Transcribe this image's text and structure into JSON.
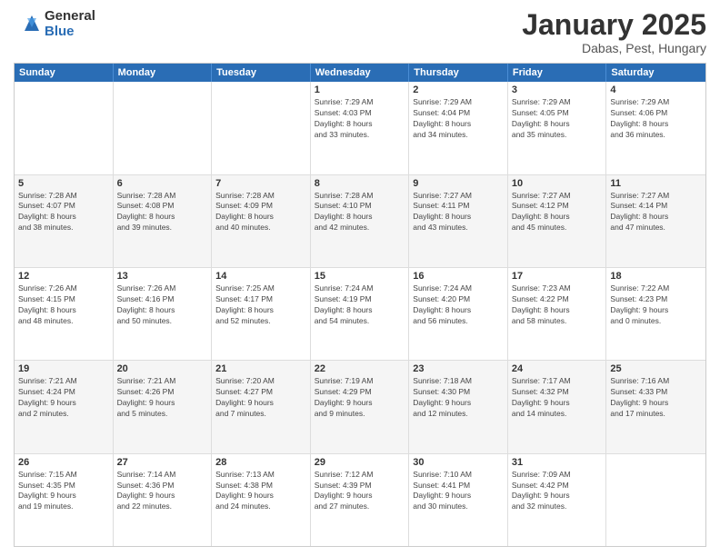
{
  "logo": {
    "general": "General",
    "blue": "Blue"
  },
  "title": "January 2025",
  "subtitle": "Dabas, Pest, Hungary",
  "header_days": [
    "Sunday",
    "Monday",
    "Tuesday",
    "Wednesday",
    "Thursday",
    "Friday",
    "Saturday"
  ],
  "rows": [
    [
      {
        "day": "",
        "text": ""
      },
      {
        "day": "",
        "text": ""
      },
      {
        "day": "",
        "text": ""
      },
      {
        "day": "1",
        "text": "Sunrise: 7:29 AM\nSunset: 4:03 PM\nDaylight: 8 hours\nand 33 minutes."
      },
      {
        "day": "2",
        "text": "Sunrise: 7:29 AM\nSunset: 4:04 PM\nDaylight: 8 hours\nand 34 minutes."
      },
      {
        "day": "3",
        "text": "Sunrise: 7:29 AM\nSunset: 4:05 PM\nDaylight: 8 hours\nand 35 minutes."
      },
      {
        "day": "4",
        "text": "Sunrise: 7:29 AM\nSunset: 4:06 PM\nDaylight: 8 hours\nand 36 minutes."
      }
    ],
    [
      {
        "day": "5",
        "text": "Sunrise: 7:28 AM\nSunset: 4:07 PM\nDaylight: 8 hours\nand 38 minutes."
      },
      {
        "day": "6",
        "text": "Sunrise: 7:28 AM\nSunset: 4:08 PM\nDaylight: 8 hours\nand 39 minutes."
      },
      {
        "day": "7",
        "text": "Sunrise: 7:28 AM\nSunset: 4:09 PM\nDaylight: 8 hours\nand 40 minutes."
      },
      {
        "day": "8",
        "text": "Sunrise: 7:28 AM\nSunset: 4:10 PM\nDaylight: 8 hours\nand 42 minutes."
      },
      {
        "day": "9",
        "text": "Sunrise: 7:27 AM\nSunset: 4:11 PM\nDaylight: 8 hours\nand 43 minutes."
      },
      {
        "day": "10",
        "text": "Sunrise: 7:27 AM\nSunset: 4:12 PM\nDaylight: 8 hours\nand 45 minutes."
      },
      {
        "day": "11",
        "text": "Sunrise: 7:27 AM\nSunset: 4:14 PM\nDaylight: 8 hours\nand 47 minutes."
      }
    ],
    [
      {
        "day": "12",
        "text": "Sunrise: 7:26 AM\nSunset: 4:15 PM\nDaylight: 8 hours\nand 48 minutes."
      },
      {
        "day": "13",
        "text": "Sunrise: 7:26 AM\nSunset: 4:16 PM\nDaylight: 8 hours\nand 50 minutes."
      },
      {
        "day": "14",
        "text": "Sunrise: 7:25 AM\nSunset: 4:17 PM\nDaylight: 8 hours\nand 52 minutes."
      },
      {
        "day": "15",
        "text": "Sunrise: 7:24 AM\nSunset: 4:19 PM\nDaylight: 8 hours\nand 54 minutes."
      },
      {
        "day": "16",
        "text": "Sunrise: 7:24 AM\nSunset: 4:20 PM\nDaylight: 8 hours\nand 56 minutes."
      },
      {
        "day": "17",
        "text": "Sunrise: 7:23 AM\nSunset: 4:22 PM\nDaylight: 8 hours\nand 58 minutes."
      },
      {
        "day": "18",
        "text": "Sunrise: 7:22 AM\nSunset: 4:23 PM\nDaylight: 9 hours\nand 0 minutes."
      }
    ],
    [
      {
        "day": "19",
        "text": "Sunrise: 7:21 AM\nSunset: 4:24 PM\nDaylight: 9 hours\nand 2 minutes."
      },
      {
        "day": "20",
        "text": "Sunrise: 7:21 AM\nSunset: 4:26 PM\nDaylight: 9 hours\nand 5 minutes."
      },
      {
        "day": "21",
        "text": "Sunrise: 7:20 AM\nSunset: 4:27 PM\nDaylight: 9 hours\nand 7 minutes."
      },
      {
        "day": "22",
        "text": "Sunrise: 7:19 AM\nSunset: 4:29 PM\nDaylight: 9 hours\nand 9 minutes."
      },
      {
        "day": "23",
        "text": "Sunrise: 7:18 AM\nSunset: 4:30 PM\nDaylight: 9 hours\nand 12 minutes."
      },
      {
        "day": "24",
        "text": "Sunrise: 7:17 AM\nSunset: 4:32 PM\nDaylight: 9 hours\nand 14 minutes."
      },
      {
        "day": "25",
        "text": "Sunrise: 7:16 AM\nSunset: 4:33 PM\nDaylight: 9 hours\nand 17 minutes."
      }
    ],
    [
      {
        "day": "26",
        "text": "Sunrise: 7:15 AM\nSunset: 4:35 PM\nDaylight: 9 hours\nand 19 minutes."
      },
      {
        "day": "27",
        "text": "Sunrise: 7:14 AM\nSunset: 4:36 PM\nDaylight: 9 hours\nand 22 minutes."
      },
      {
        "day": "28",
        "text": "Sunrise: 7:13 AM\nSunset: 4:38 PM\nDaylight: 9 hours\nand 24 minutes."
      },
      {
        "day": "29",
        "text": "Sunrise: 7:12 AM\nSunset: 4:39 PM\nDaylight: 9 hours\nand 27 minutes."
      },
      {
        "day": "30",
        "text": "Sunrise: 7:10 AM\nSunset: 4:41 PM\nDaylight: 9 hours\nand 30 minutes."
      },
      {
        "day": "31",
        "text": "Sunrise: 7:09 AM\nSunset: 4:42 PM\nDaylight: 9 hours\nand 32 minutes."
      },
      {
        "day": "",
        "text": ""
      }
    ]
  ]
}
